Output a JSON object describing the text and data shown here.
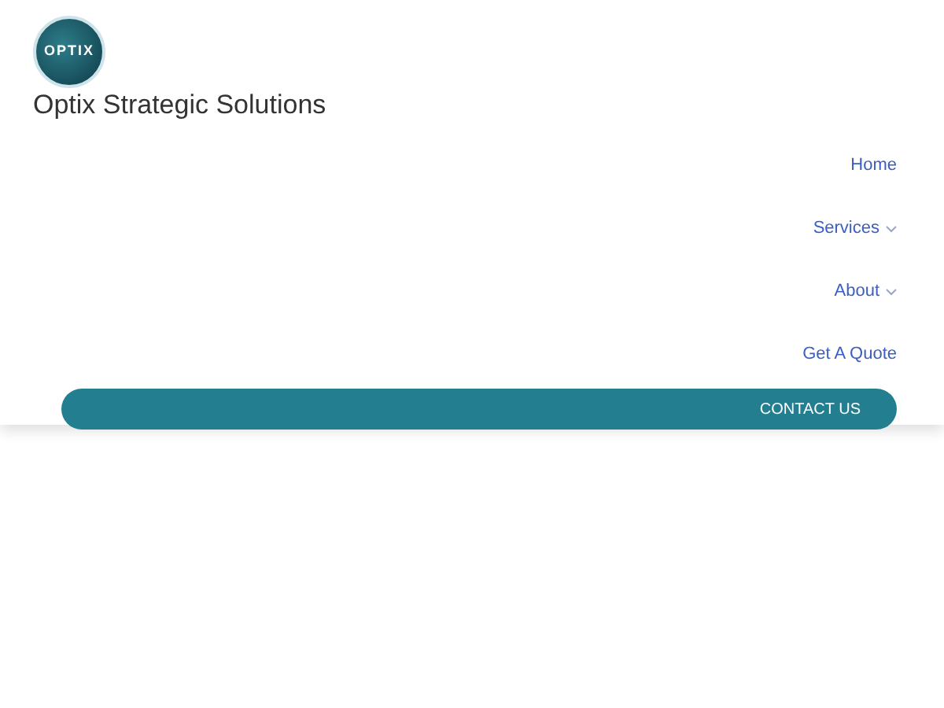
{
  "logo": {
    "text": "OPTIX"
  },
  "site_title": "Optix Strategic Solutions",
  "nav": [
    {
      "label": "Home",
      "has_submenu": false
    },
    {
      "label": "Services",
      "has_submenu": true
    },
    {
      "label": "About",
      "has_submenu": true
    },
    {
      "label": "Get A Quote",
      "has_submenu": false
    }
  ],
  "cta": {
    "label": "CONTACT US"
  }
}
